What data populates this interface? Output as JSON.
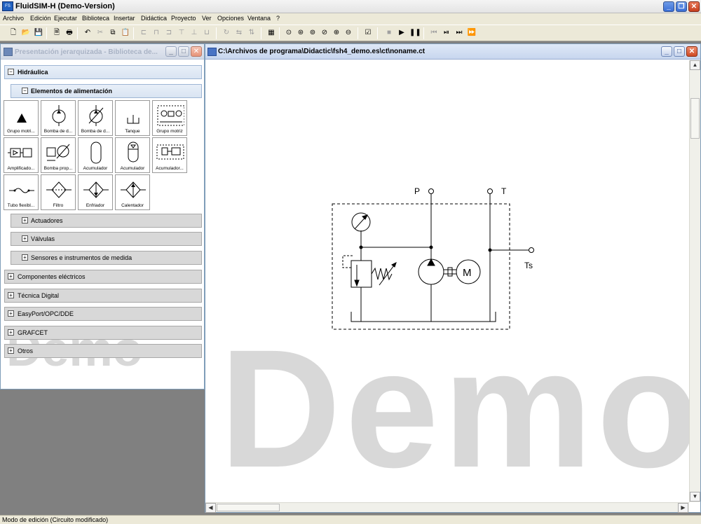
{
  "app": {
    "title": "FluidSIM-H (Demo-Version)",
    "icon": "fluidsim-app-icon"
  },
  "menu": [
    "Archivo",
    "Edición",
    "Ejecutar",
    "Biblioteca",
    "Insertar",
    "Didáctica",
    "Proyecto",
    "Ver",
    "Opciones",
    "Ventana",
    "?"
  ],
  "library": {
    "title": "Presentación jerarquizada - Biblioteca de...",
    "watermark": "Demo",
    "root_hydraulics": "Hidráulica",
    "supply_group": "Elementos de alimentación",
    "tiles": [
      "Grupo motri...",
      "Bomba de d...",
      "Bomba de d...",
      "Tanque",
      "Grupo motriz",
      "Amplificado...",
      "Bomba prop...",
      "Acumulador",
      "Acumulador",
      "Acumulador...",
      "Tubo flexibl...",
      "Filtro",
      "Enfriador",
      "Calentador"
    ],
    "subgroups": [
      "Actuadores",
      "Válvulas",
      "Sensores e instrumentos de medida"
    ],
    "groups": [
      "Componentes eléctricos",
      "Técnica Digital",
      "EasyPort/OPC/DDE",
      "GRAFCET",
      "Otros"
    ]
  },
  "circuit": {
    "title": "C:\\Archivos de programa\\Didactic\\fsh4_demo.es\\ct\\noname.ct",
    "watermark": "Demo",
    "labels": {
      "p": "P",
      "t": "T",
      "ts": "Ts",
      "motor": "M"
    }
  },
  "status": "Modo de edición (Circuito modificado)"
}
